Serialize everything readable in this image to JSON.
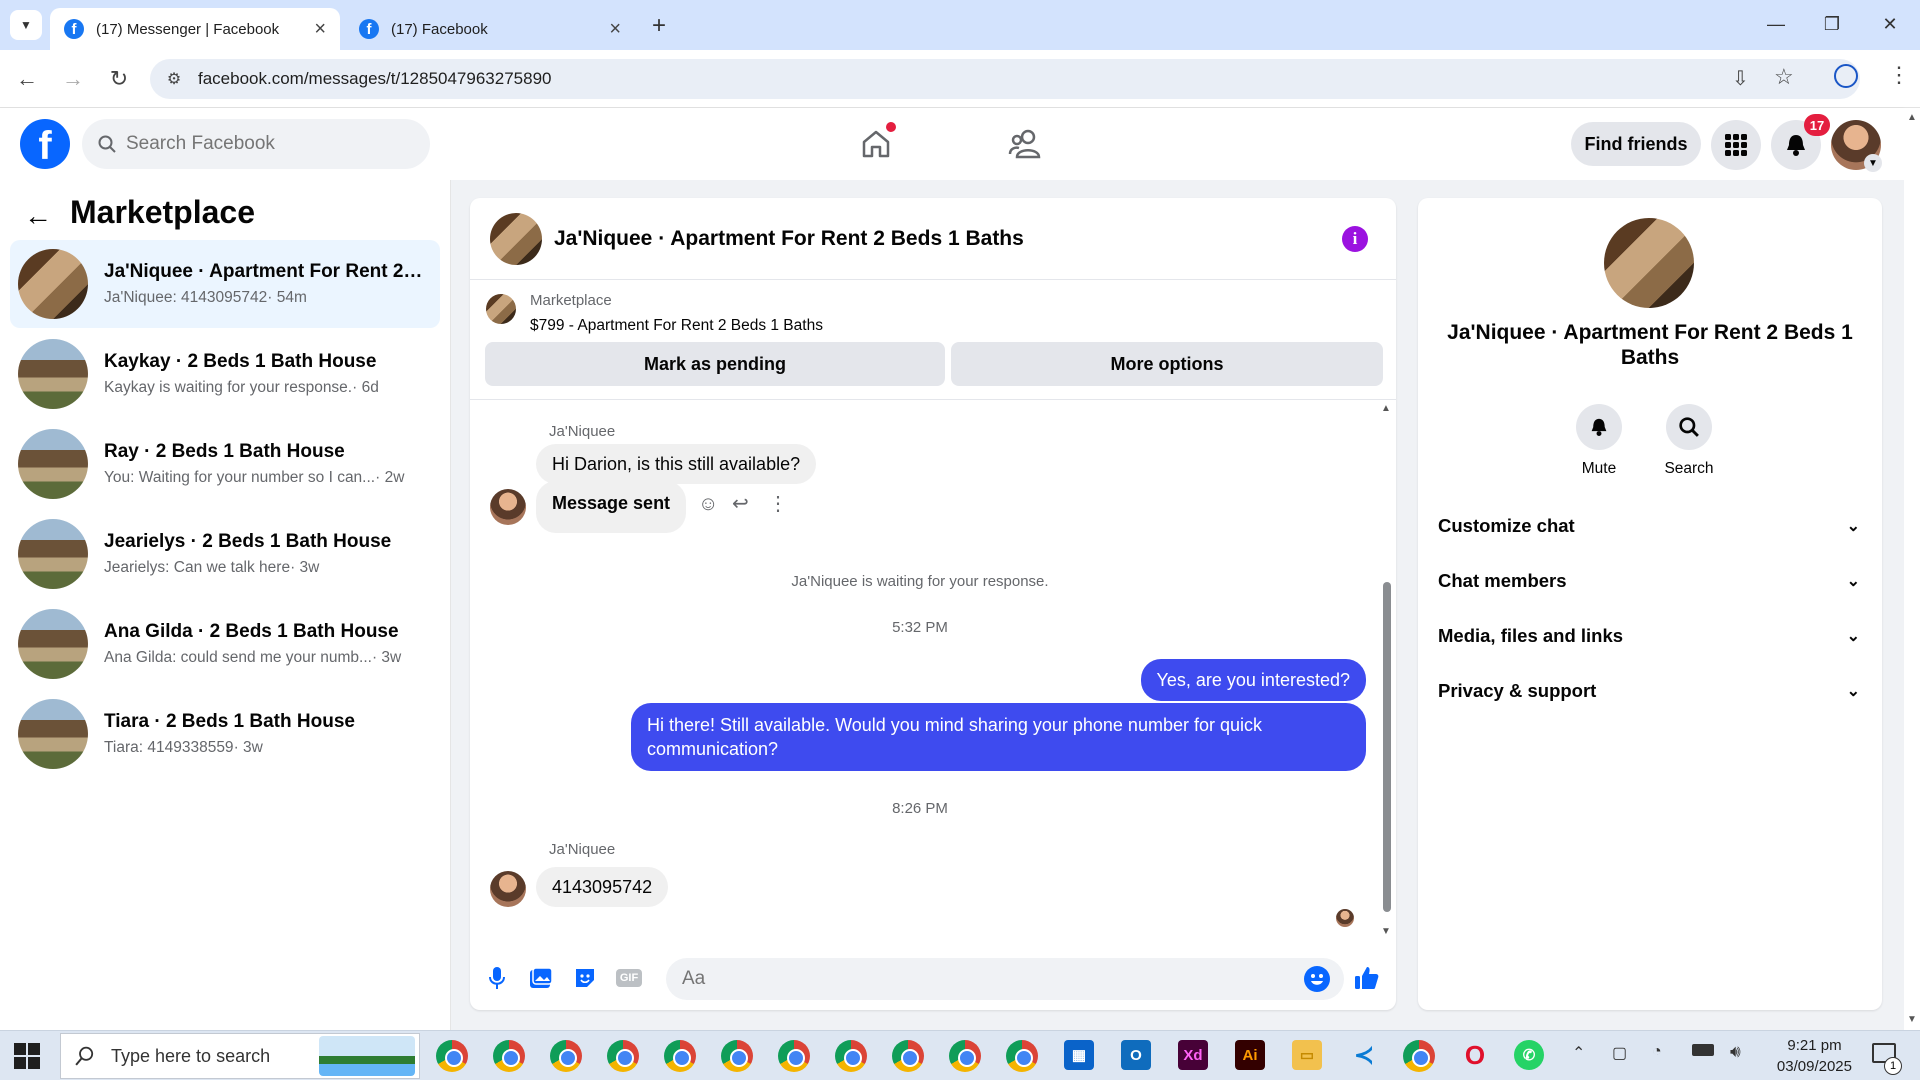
{
  "browser": {
    "tabs": [
      {
        "title": "(17) Messenger | Facebook",
        "active": true
      },
      {
        "title": "(17) Facebook",
        "active": false
      }
    ],
    "url": "facebook.com/messages/t/1285047963275890"
  },
  "header": {
    "search_placeholder": "Search Facebook",
    "find_friends": "Find friends",
    "notification_count": "17"
  },
  "sidebar": {
    "title": "Marketplace",
    "conversations": [
      {
        "name": "Ja'Niquee · Apartment For Rent 2 ...",
        "snippet": "Ja'Niquee: 4143095742",
        "time": "· 54m",
        "active": true,
        "pic": "apartment"
      },
      {
        "name": "Kaykay · 2 Beds 1 Bath House",
        "snippet": "Kaykay is waiting for your response.",
        "time": "· 6d",
        "active": false,
        "pic": "house"
      },
      {
        "name": "Ray · 2 Beds 1 Bath House",
        "snippet": "You: Waiting for your number so I can...",
        "time": "· 2w",
        "active": false,
        "pic": "house"
      },
      {
        "name": "Jearielys · 2 Beds 1 Bath House",
        "snippet": "Jearielys: Can we talk here",
        "time": "· 3w",
        "active": false,
        "pic": "house"
      },
      {
        "name": "Ana Gilda · 2 Beds 1 Bath House",
        "snippet": "Ana Gilda: could send me your numb...",
        "time": "· 3w",
        "active": false,
        "pic": "house"
      },
      {
        "name": "Tiara · 2 Beds 1 Bath House",
        "snippet": "Tiara: 4149338559",
        "time": "· 3w",
        "active": false,
        "pic": "house"
      }
    ]
  },
  "chat": {
    "title": "Ja'Niquee · Apartment For Rent 2 Beds 1 Baths",
    "marketplace_label": "Marketplace",
    "listing": "$799 - Apartment For Rent 2 Beds 1 Baths",
    "mark_pending": "Mark as pending",
    "more_options": "More options",
    "sender_name": "Ja'Niquee",
    "msg1": "Hi Darion, is this still available?",
    "msg2": "Message sent",
    "waiting_note": "Ja'Niquee is waiting for your response.",
    "time1": "5:32 PM",
    "out1": "Yes, are you interested?",
    "out2": "Hi there! Still available. Would you mind sharing your phone number for quick communication?",
    "time2": "8:26 PM",
    "msg3": "4143095742",
    "composer_placeholder": "Aa"
  },
  "info": {
    "title": "Ja'Niquee · Apartment For Rent 2 Beds 1 Baths",
    "mute": "Mute",
    "search": "Search",
    "sections": [
      "Customize chat",
      "Chat members",
      "Media, files and links",
      "Privacy & support"
    ]
  },
  "taskbar": {
    "search_placeholder": "Type here to search",
    "time": "9:21 pm",
    "date": "03/09/2025",
    "notif_count": "1"
  },
  "colors": {
    "fb_blue": "#0866ff",
    "outgoing_bubble": "#3e4bef",
    "active_conv": "#ebf5ff",
    "badge_red": "#e41e3f"
  }
}
